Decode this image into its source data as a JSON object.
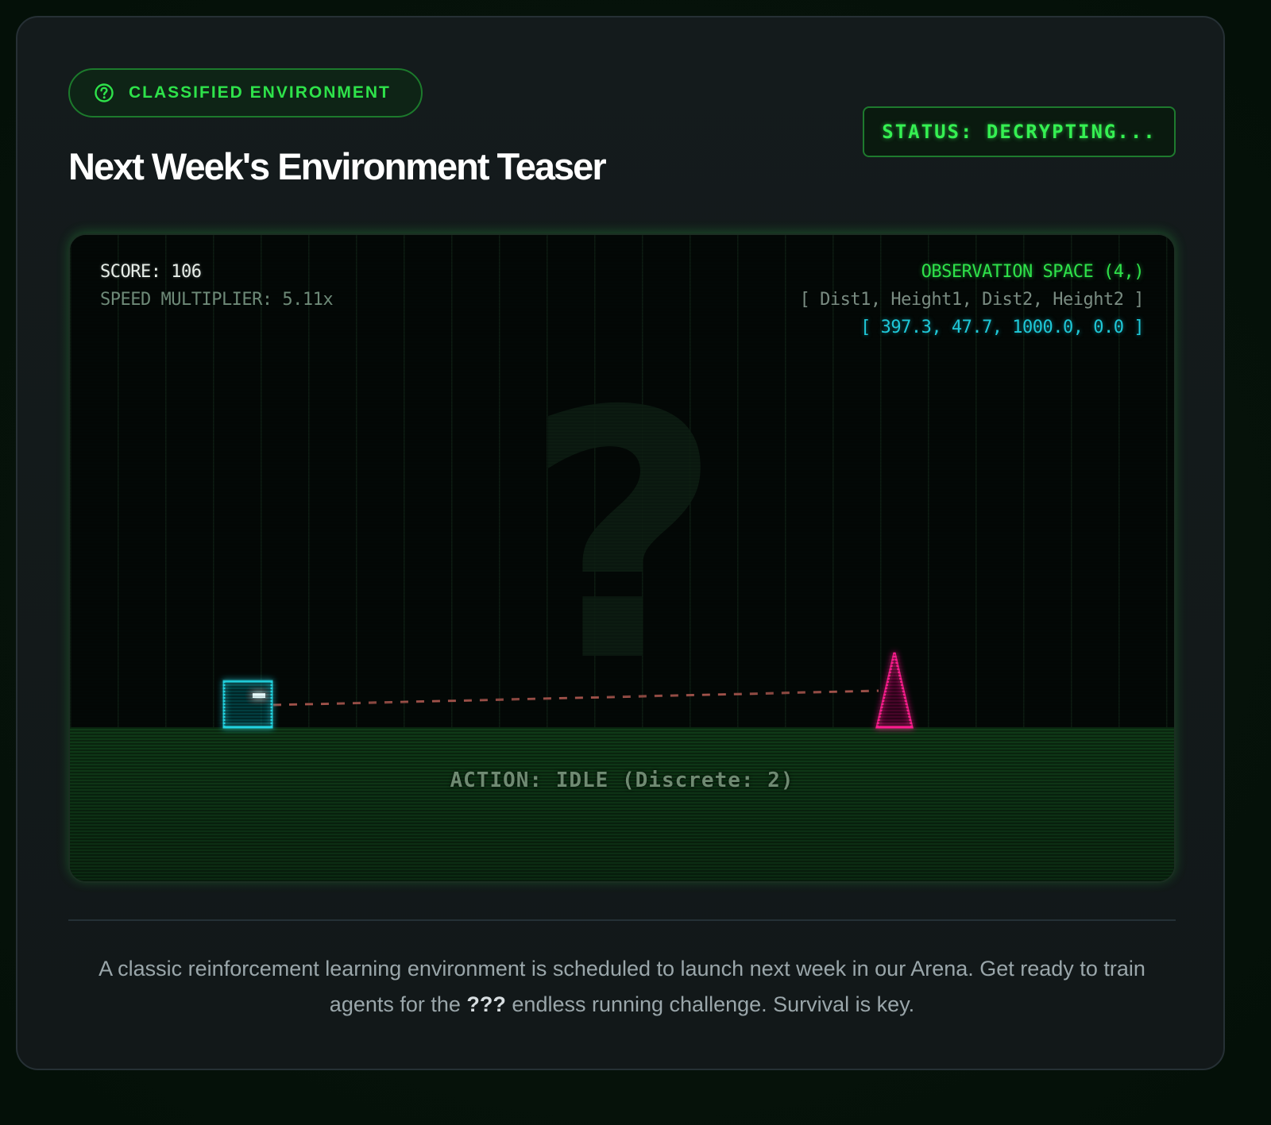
{
  "badge": {
    "label": "CLASSIFIED ENVIRONMENT",
    "icon": "question-circle-icon",
    "color": "#2ee24a"
  },
  "title": "Next Week's Environment Teaser",
  "status": {
    "text": "STATUS: DECRYPTING..."
  },
  "game": {
    "score_label": "SCORE: 106",
    "speed_label": "SPEED MULTIPLIER: 5.11x",
    "observation_title": "OBSERVATION SPACE (4,)",
    "observation_labels": "[ Dist1, Height1, Dist2, Height2 ]",
    "observation_values": "[ 397.3, 47.7, 1000.0, 0.0 ]",
    "action_label": "ACTION: IDLE (Discrete: 2)",
    "player_color": "#22d3e0",
    "obstacle_color": "#ff1f8f",
    "ground_color": "#2ee24a",
    "watermark_glyph": "?"
  },
  "description": {
    "before": "A classic reinforcement learning environment is scheduled to launch next week in our Arena. Get ready to train agents for the ",
    "highlight": "???",
    "after": " endless running challenge. Survival is key."
  }
}
